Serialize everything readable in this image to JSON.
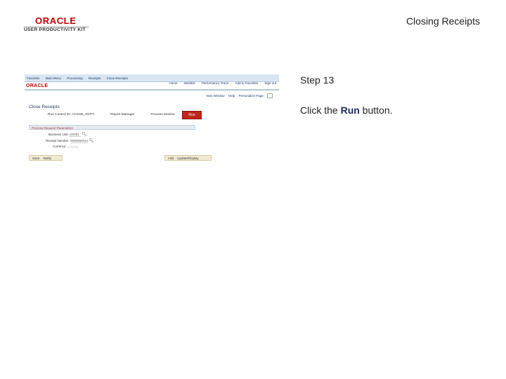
{
  "header": {
    "logo_brand": "ORACLE",
    "logo_sub": "USER PRODUCTIVITY KIT",
    "title": "Closing Receipts"
  },
  "screenshot": {
    "breadcrumbs": [
      "Favorites",
      "Main Menu",
      "Processing",
      "Receipts",
      "Close Receipts"
    ],
    "brand": "ORACLE",
    "top_nav": [
      "Home",
      "Worklist",
      "Performance Trace",
      "Add to Favorites",
      "Sign out"
    ],
    "page_links": [
      "New Window",
      "Help",
      "Personalize Page"
    ],
    "page_title": "Close Receipts",
    "run_control_label": "Run Control ID:",
    "run_control_value": "CLOSE_RCPT",
    "report_manager": "Report Manager",
    "process_monitor": "Process Monitor",
    "run_button": "Run",
    "section_title": "Process Request Parameters",
    "business_unit_label": "Business Unit:",
    "business_unit_value": "US001",
    "receipt_number_label": "Receipt Number:",
    "receipt_number_value": "0000000014",
    "currency_label": "Currency:",
    "save": "Save",
    "notify": "Notify",
    "add": "Add",
    "update_display": "Update/Display"
  },
  "step": {
    "number": "Step 13",
    "instruction_prefix": "Click the ",
    "instruction_bold": "Run",
    "instruction_suffix": " button."
  }
}
